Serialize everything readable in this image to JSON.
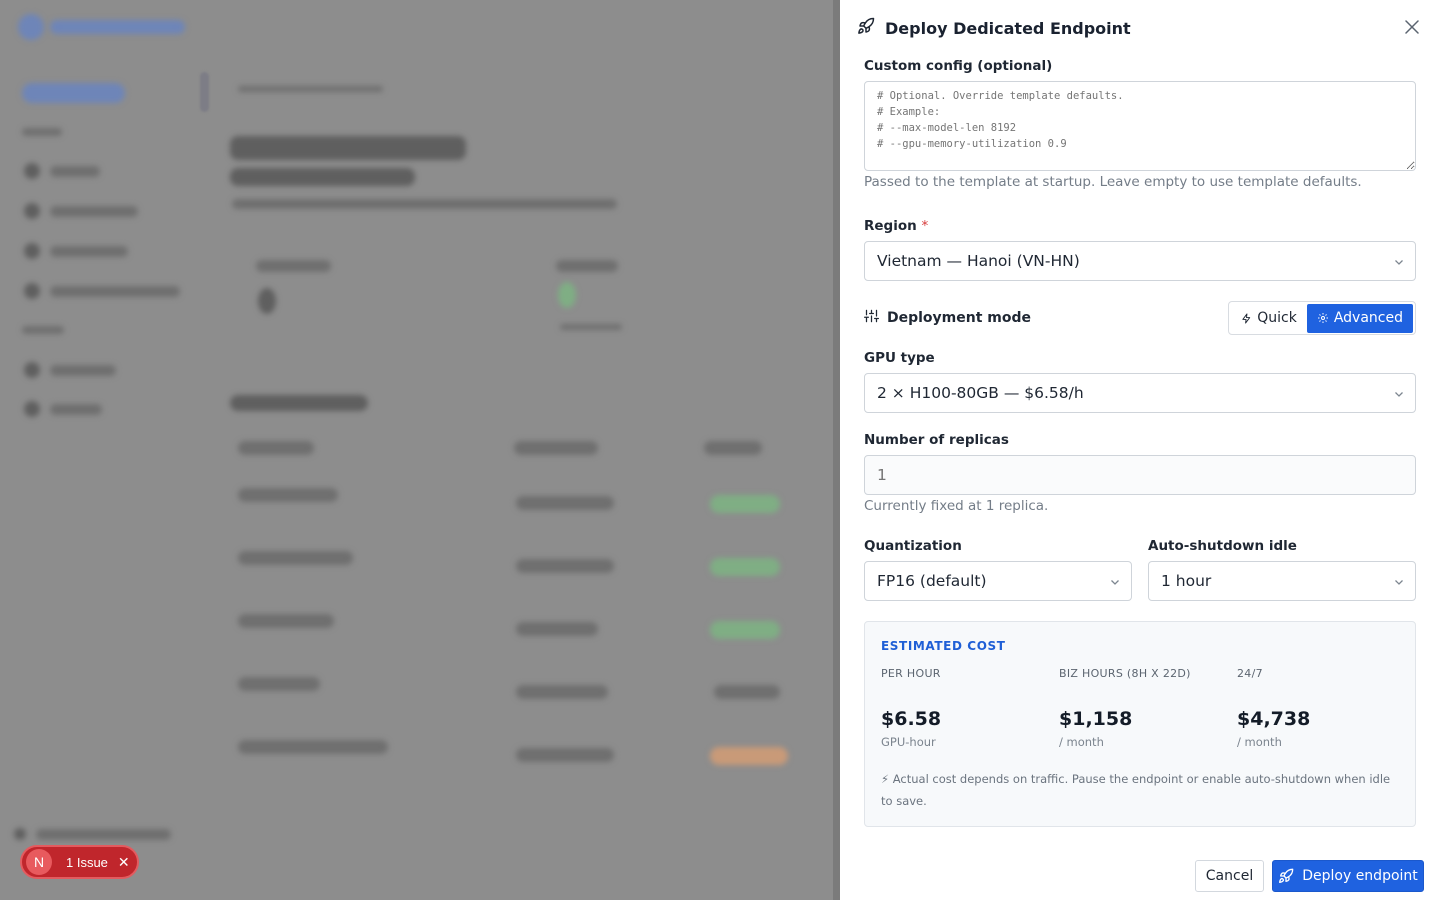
{
  "drawer": {
    "title": "Deploy Dedicated Endpoint",
    "custom_config": {
      "label": "Custom config (optional)",
      "placeholder": "# Optional. Override template defaults.\n# Example:\n# --max-model-len 8192\n# --gpu-memory-utilization 0.9",
      "help": "Passed to the template at startup. Leave empty to use template defaults."
    },
    "region": {
      "label": "Region",
      "required_mark": "*",
      "value": "Vietnam — Hanoi (VN-HN)"
    },
    "deployment_mode": {
      "label": "Deployment mode",
      "options": [
        "Quick",
        "Advanced"
      ],
      "selected": "Advanced"
    },
    "gpu_type": {
      "label": "GPU type",
      "value": "2 × H100-80GB — $6.58/h"
    },
    "replicas": {
      "label": "Number of replicas",
      "placeholder": "1",
      "help": "Currently fixed at 1 replica."
    },
    "quantization": {
      "label": "Quantization",
      "value": "FP16 (default)"
    },
    "auto_shutdown": {
      "label": "Auto-shutdown idle",
      "value": "1 hour"
    },
    "estimated_cost": {
      "title": "ESTIMATED COST",
      "columns": [
        {
          "header": "PER HOUR",
          "amount": "$6.58",
          "unit": "GPU-hour"
        },
        {
          "header": "BIZ HOURS (8H X 22D)",
          "amount": "$1,158",
          "unit": "/ month"
        },
        {
          "header": "24/7",
          "amount": "$4,738",
          "unit": "/ month"
        }
      ],
      "note": "⚡ Actual cost depends on traffic. Pause the endpoint or enable auto-shutdown when idle to save."
    },
    "footer": {
      "cancel_label": "Cancel",
      "deploy_label": "Deploy endpoint"
    }
  },
  "issue_badge": {
    "avatar_letter": "N",
    "text": "1 Issue"
  },
  "colors": {
    "primary": "#1f62e0",
    "cost_title": "#1f5fd6",
    "issue_red": "#c0262c",
    "overlay": "#8d8d8d"
  }
}
